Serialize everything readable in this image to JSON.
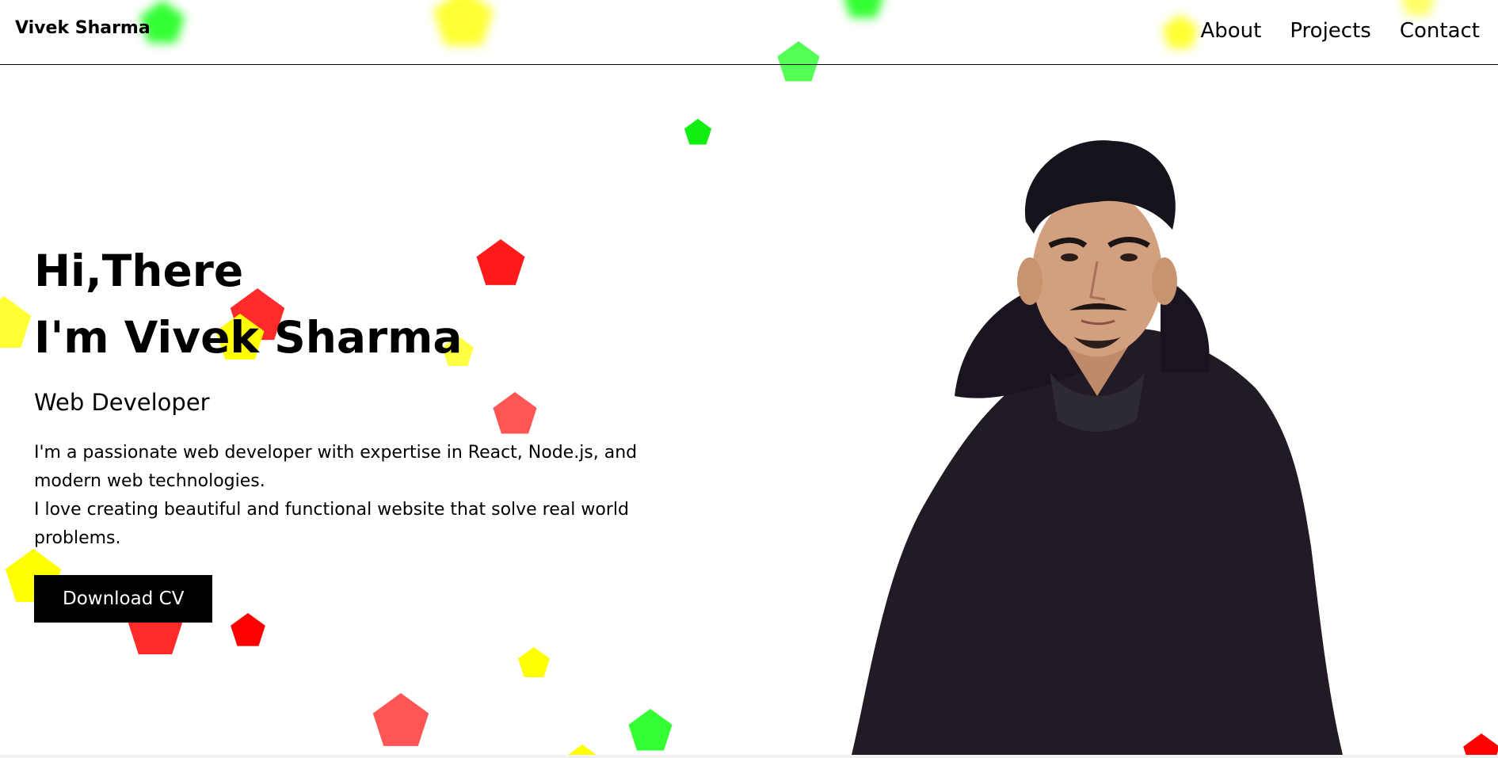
{
  "header": {
    "brand": "Vivek Sharma",
    "nav": [
      "About",
      "Projects",
      "Contact"
    ]
  },
  "hero": {
    "greeting": "Hi,There",
    "intro": "I'm Vivek Sharma",
    "role": "Web Developer",
    "bio_line_1": "I'm a passionate web developer with expertise in React, Node.js, and modern web technologies.",
    "bio_line_2": "I love creating beautiful and functional website that solve real world problems.",
    "cta_label": "Download CV"
  },
  "colors": {
    "red": "#ff1a1a",
    "yellow": "#ffff00",
    "green": "#33ff33",
    "text": "#000000",
    "button_bg": "#000000",
    "button_text": "#ffffff"
  },
  "icons": [
    "pentagon-shape",
    "profile-photo"
  ]
}
